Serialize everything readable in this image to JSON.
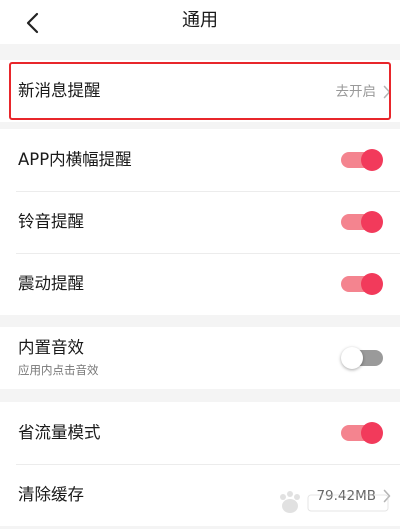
{
  "header": {
    "title": "通用"
  },
  "new_message": {
    "label": "新消息提醒",
    "value": "去开启"
  },
  "notifications": [
    {
      "label": "APP内横幅提醒",
      "enabled": true
    },
    {
      "label": "铃音提醒",
      "enabled": true
    },
    {
      "label": "震动提醒",
      "enabled": true
    }
  ],
  "sound": {
    "label": "内置音效",
    "sub": "应用内点击音效",
    "enabled": false
  },
  "data_saver": {
    "label": "省流量模式",
    "enabled": true
  },
  "cache": {
    "label": "清除缓存",
    "value": "79.42MB"
  },
  "colors": {
    "accent": "#f23a5b",
    "highlight": "#e8262b"
  }
}
